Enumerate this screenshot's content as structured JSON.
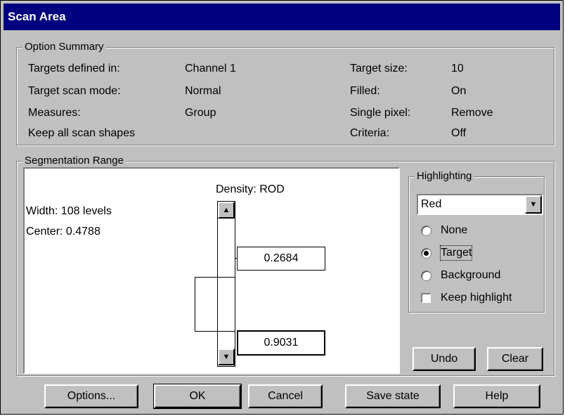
{
  "window": {
    "title": "Scan Area"
  },
  "option_summary": {
    "legend": "Option Summary",
    "rows": [
      {
        "label": "Targets defined in:",
        "value": "Channel 1",
        "label2": "Target size:",
        "value2": "10"
      },
      {
        "label": "Target scan mode:",
        "value": "Normal",
        "label2": "Filled:",
        "value2": "On"
      },
      {
        "label": "Measures:",
        "value": "Group",
        "label2": "Single pixel:",
        "value2": "Remove"
      },
      {
        "label": "Keep all scan shapes",
        "value": "",
        "label2": "Criteria:",
        "value2": "Off"
      }
    ]
  },
  "segmentation": {
    "legend": "Segmentation Range",
    "density_label": "Density: ROD",
    "width_text": "Width:  108 levels",
    "center_text": "Center: 0.4788",
    "upper_value": "0.2684",
    "lower_value": "0.9031"
  },
  "highlighting": {
    "legend": "Highlighting",
    "color_select": "Red",
    "options": [
      {
        "label": "None",
        "selected": false
      },
      {
        "label": "Target",
        "selected": true
      },
      {
        "label": "Background",
        "selected": false
      }
    ],
    "keep_highlight": {
      "label": "Keep highlight",
      "checked": false
    },
    "undo": "Undo",
    "clear": "Clear"
  },
  "footer": {
    "options": "Options...",
    "ok": "OK",
    "cancel": "Cancel",
    "save_state": "Save state",
    "help": "Help"
  },
  "icons": {
    "scroll_up": "triangle-up-icon",
    "scroll_down": "triangle-down-icon",
    "dropdown": "triangle-down-icon"
  }
}
